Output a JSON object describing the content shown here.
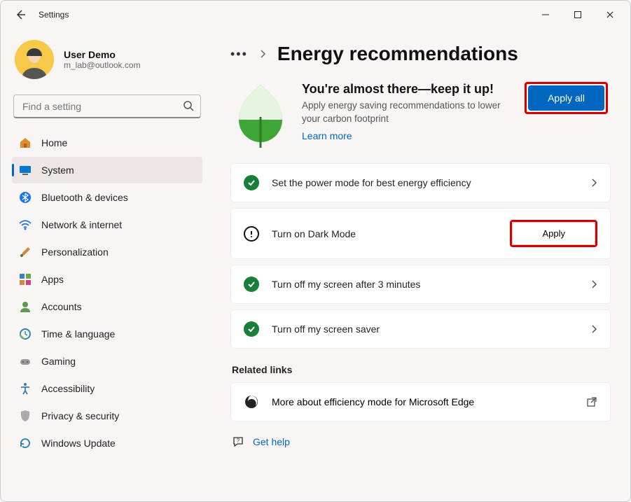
{
  "window": {
    "title": "Settings"
  },
  "user": {
    "name": "User Demo",
    "email": "m_lab@outlook.com"
  },
  "search": {
    "placeholder": "Find a setting"
  },
  "nav": {
    "home": "Home",
    "system": "System",
    "bluetooth": "Bluetooth & devices",
    "network": "Network & internet",
    "personalization": "Personalization",
    "apps": "Apps",
    "accounts": "Accounts",
    "time": "Time & language",
    "gaming": "Gaming",
    "accessibility": "Accessibility",
    "privacy": "Privacy & security",
    "update": "Windows Update"
  },
  "page": {
    "breadcrumb_more": "•••",
    "title": "Energy recommendations"
  },
  "hero": {
    "heading": "You're almost there—keep it up!",
    "body": "Apply energy saving recommendations to lower your carbon footprint",
    "learn_more": "Learn more",
    "apply_all": "Apply all"
  },
  "recs": [
    {
      "status": "ok",
      "text": "Set the power mode for best energy efficiency",
      "action": "chevron"
    },
    {
      "status": "warn",
      "text": "Turn on Dark Mode",
      "action": "apply",
      "apply_label": "Apply"
    },
    {
      "status": "ok",
      "text": "Turn off my screen after 3 minutes",
      "action": "chevron"
    },
    {
      "status": "ok",
      "text": "Turn off my screen saver",
      "action": "chevron"
    }
  ],
  "related": {
    "heading": "Related links",
    "edge": "More about efficiency mode for Microsoft Edge"
  },
  "help": {
    "label": "Get help"
  }
}
